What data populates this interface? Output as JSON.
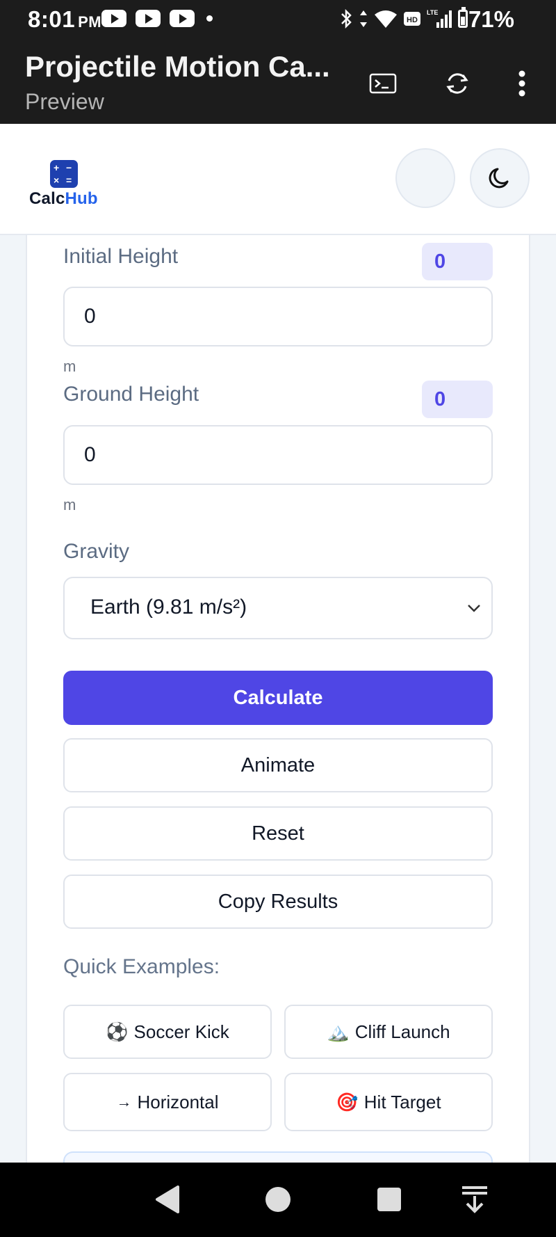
{
  "status_bar": {
    "time": "8:01",
    "ampm": "PM",
    "battery_percent": "71%",
    "icons": [
      "youtube-icon",
      "youtube-icon",
      "youtube-icon",
      "dot-icon",
      "bluetooth-icon",
      "data-arrows-icon",
      "wifi-icon",
      "hd-icon",
      "lte-icon",
      "signal-icon",
      "battery-icon"
    ],
    "hd_label": "HD",
    "lte_label": "LTE"
  },
  "app_bar": {
    "title": "Projectile Motion Ca...",
    "subtitle": "Preview",
    "icons": [
      "terminal-icon",
      "refresh-icon",
      "more-vert-icon"
    ]
  },
  "header": {
    "logo_prefix": "Calc",
    "logo_suffix": "Hub",
    "logo_symbols": [
      "+",
      "−",
      "×",
      "="
    ],
    "icons": [
      "blank-circle",
      "moon-icon"
    ]
  },
  "form": {
    "initial_height": {
      "label": "Initial Height",
      "badge": "0",
      "value": "0",
      "unit": "m"
    },
    "ground_height": {
      "label": "Ground Height",
      "badge": "0",
      "value": "0",
      "unit": "m"
    },
    "gravity": {
      "label": "Gravity",
      "selected": "Earth (9.81 m/s²)"
    }
  },
  "buttons": {
    "calculate": "Calculate",
    "animate": "Animate",
    "reset": "Reset",
    "copy": "Copy Results"
  },
  "examples": {
    "title": "Quick Examples:",
    "items": [
      {
        "icon": "⚽",
        "label": "Soccer Kick"
      },
      {
        "icon": "🏔️",
        "label": "Cliff Launch"
      },
      {
        "icon": "→",
        "label": "Horizontal"
      },
      {
        "icon": "🎯",
        "label": "Hit Target"
      }
    ]
  },
  "colors": {
    "primary": "#4f46e5",
    "badge_bg": "#e8e9fc",
    "brand_blue": "#2563eb",
    "dark_bar": "#1c1c1c"
  },
  "nav_bar": {
    "icons": [
      "back-icon",
      "home-icon",
      "recents-icon",
      "keyboard-hide-icon"
    ]
  }
}
